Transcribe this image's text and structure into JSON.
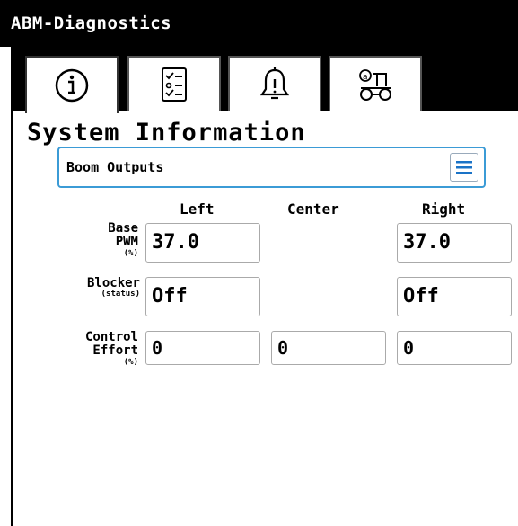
{
  "app": {
    "title": "ABM-Diagnostics"
  },
  "tabs": [
    {
      "icon": "info-icon",
      "active": true
    },
    {
      "icon": "checklist-icon",
      "active": false
    },
    {
      "icon": "bell-icon",
      "active": false
    },
    {
      "icon": "tractor-icon",
      "active": false
    }
  ],
  "page": {
    "title": "System Information"
  },
  "selector": {
    "value": "Boom Outputs",
    "menu_icon": "menu-icon"
  },
  "columns": {
    "left": "Left",
    "center": "Center",
    "right": "Right"
  },
  "rows": {
    "base_pwm": {
      "label_line1": "Base",
      "label_line2": "PWM",
      "unit": "(%)",
      "left": "37.0",
      "right": "37.0"
    },
    "blocker": {
      "label": "Blocker",
      "unit": "(status)",
      "left": "Off",
      "right": "Off"
    },
    "control_effort": {
      "label_line1": "Control",
      "label_line2": "Effort",
      "unit": "(%)",
      "left": "0",
      "center": "0",
      "right": "0"
    }
  },
  "colors": {
    "title_bar": "#000000",
    "accent": "#3b9bd6",
    "background": "#ffffff"
  }
}
